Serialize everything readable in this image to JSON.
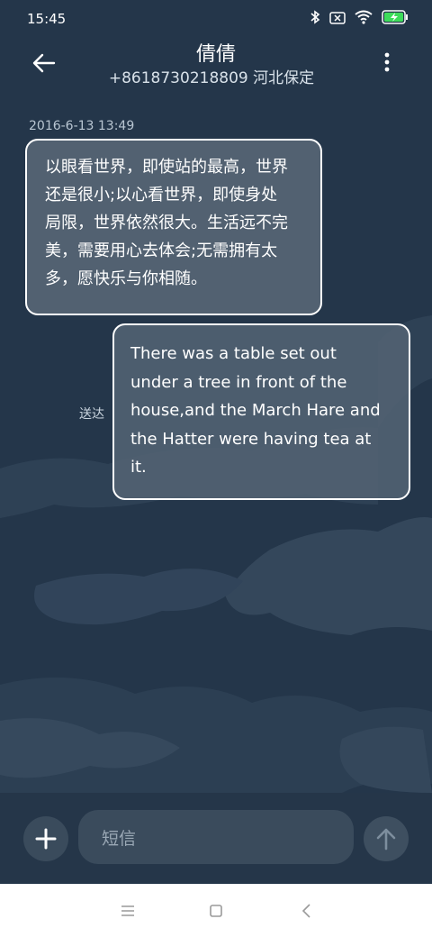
{
  "status_bar": {
    "time": "15:45",
    "icons": [
      "bluetooth-icon",
      "sim-icon",
      "wifi-icon",
      "battery-charging-icon"
    ]
  },
  "header": {
    "back_icon": "back-arrow-icon",
    "contact_name": "倩倩",
    "contact_info": "+8618730218809 河北保定",
    "menu_icon": "more-vertical-icon"
  },
  "conversation": {
    "timestamp": "2016-6-13 13:49",
    "messages": [
      {
        "direction": "incoming",
        "lines": [
          "以眼看世界，即使站的最高，世界",
          "还是很小;以心看世界，即使身处",
          "局限，世界依然很大。生活远不完",
          "美，需要用心去体会;无需拥有太",
          "多，愿快乐与你相随。"
        ]
      },
      {
        "direction": "outgoing",
        "status": "送达",
        "lines": [
          "There was a table set out",
          "under a tree in front of the",
          "house,and the March Hare and",
          "the Hatter were having tea at",
          "it."
        ]
      }
    ]
  },
  "composer": {
    "add_icon": "plus-icon",
    "placeholder": "短信",
    "send_icon": "arrow-up-icon"
  },
  "nav_bar": {
    "icons": [
      "menu-icon",
      "home-icon",
      "back-icon"
    ]
  },
  "colors": {
    "background": "#24364a",
    "bubble": "#5a6978",
    "input_bg": "#3a4b5c"
  }
}
